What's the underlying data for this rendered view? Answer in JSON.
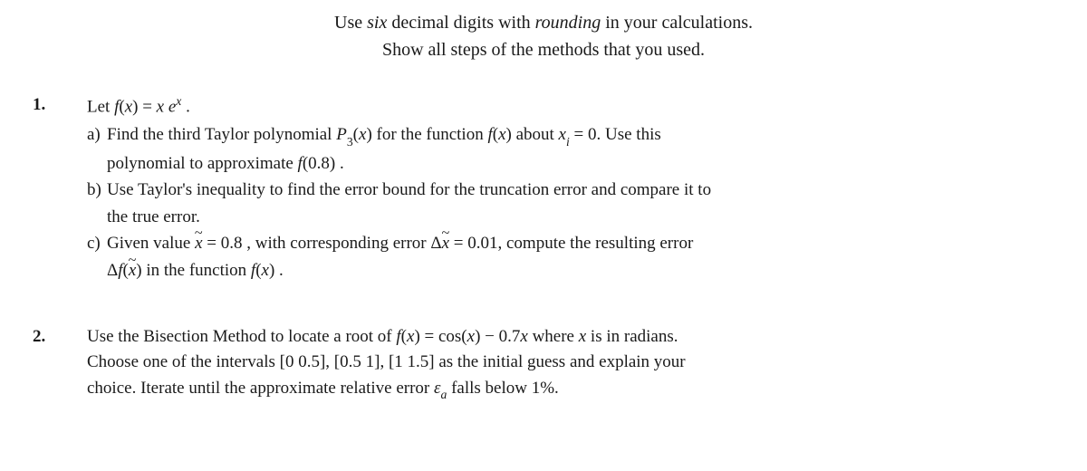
{
  "instructions": {
    "line1_a": "Use ",
    "line1_b": "six",
    "line1_c": " decimal digits with ",
    "line1_d": "rounding",
    "line1_e": " in your calculations.",
    "line2": "Show all steps of the methods that you used."
  },
  "problems": [
    {
      "number": "1.",
      "intro_parts": {
        "t1": "Let ",
        "t2": "f",
        "t3": "(",
        "t4": "x",
        "t5": ") = ",
        "t6": "x e",
        "t7": "x",
        "t8": " ."
      },
      "parts": {
        "a": {
          "label": "a)",
          "l1": {
            "t1": "Find the third Taylor polynomial ",
            "t2": "P",
            "t3": "3",
            "t4": "(",
            "t5": "x",
            "t6": ") for the function ",
            "t7": "f",
            "t8": "(",
            "t9": "x",
            "t10": ") about ",
            "t11": "x",
            "t12": "i",
            "t13": " = 0. Use this"
          },
          "l2": {
            "t1": "polynomial to approximate ",
            "t2": "f",
            "t3": "(0.8) ."
          }
        },
        "b": {
          "label": "b)",
          "l1": "Use Taylor's inequality to find the error bound for the truncation error and compare it to",
          "l2": "the true error."
        },
        "c": {
          "label": "c)",
          "l1": {
            "t1": "Given value ",
            "t2": "x",
            "t3": " = 0.8 , with corresponding error Δ",
            "t4": "x",
            "t5": " = 0.01, compute the resulting error"
          },
          "l2": {
            "t1": "Δ",
            "t2": "f",
            "t3": "(",
            "t4": "x",
            "t5": ") in the function ",
            "t6": "f",
            "t7": "(",
            "t8": "x",
            "t9": ") ."
          }
        }
      }
    },
    {
      "number": "2.",
      "body": {
        "l1": {
          "t1": "Use the Bisection Method to locate a root of ",
          "t2": "f",
          "t3": "(",
          "t4": "x",
          "t5": ") = cos(",
          "t6": "x",
          "t7": ") − 0.7",
          "t8": "x",
          "t9": " where ",
          "t10": "x",
          "t11": " is in radians."
        },
        "l2": "Choose one of the intervals [0 0.5], [0.5 1], [1 1.5] as the initial guess and explain your",
        "l3": {
          "t1": "choice. Iterate until the approximate relative error ",
          "t2": "ε",
          "t3": "a",
          "t4": " falls below 1%."
        }
      }
    }
  ]
}
